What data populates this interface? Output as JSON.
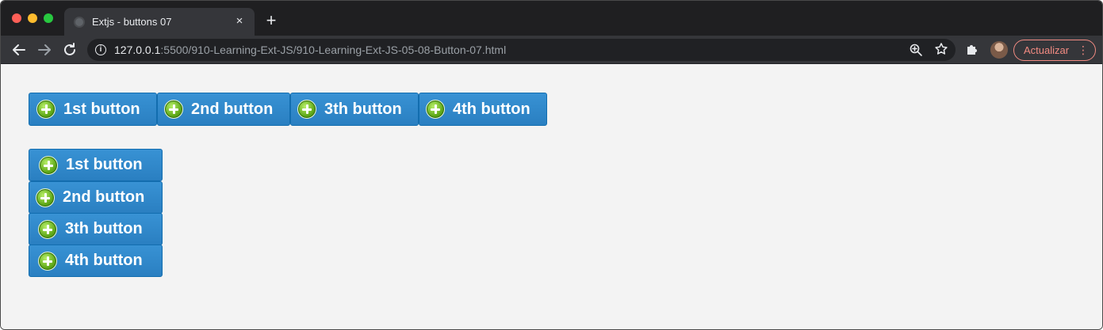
{
  "browser": {
    "tab_title": "Extjs - buttons 07",
    "tab_close": "×",
    "new_tab": "+",
    "url_host": "127.0.0.1",
    "url_path": ":5500/910-Learning-Ext-JS/910-Learning-Ext-JS-05-08-Button-07.html",
    "info_glyph": "i",
    "update_label": "Actualizar",
    "update_menu": "⋮"
  },
  "horizontal_buttons": [
    {
      "label": "1st button",
      "icon": "add-icon"
    },
    {
      "label": "2nd button",
      "icon": "add-icon"
    },
    {
      "label": "3th button",
      "icon": "add-icon"
    },
    {
      "label": "4th button",
      "icon": "add-icon"
    }
  ],
  "vertical_buttons": [
    {
      "label": "1st button",
      "icon": "add-icon"
    },
    {
      "label": "2nd button",
      "icon": "add-icon"
    },
    {
      "label": "3th button",
      "icon": "add-icon"
    },
    {
      "label": "4th button",
      "icon": "add-icon"
    }
  ],
  "colors": {
    "button_bg": "#2a7fc1",
    "button_border": "#126daf",
    "icon_green": "#5fa818",
    "update_accent": "#f28b82"
  }
}
